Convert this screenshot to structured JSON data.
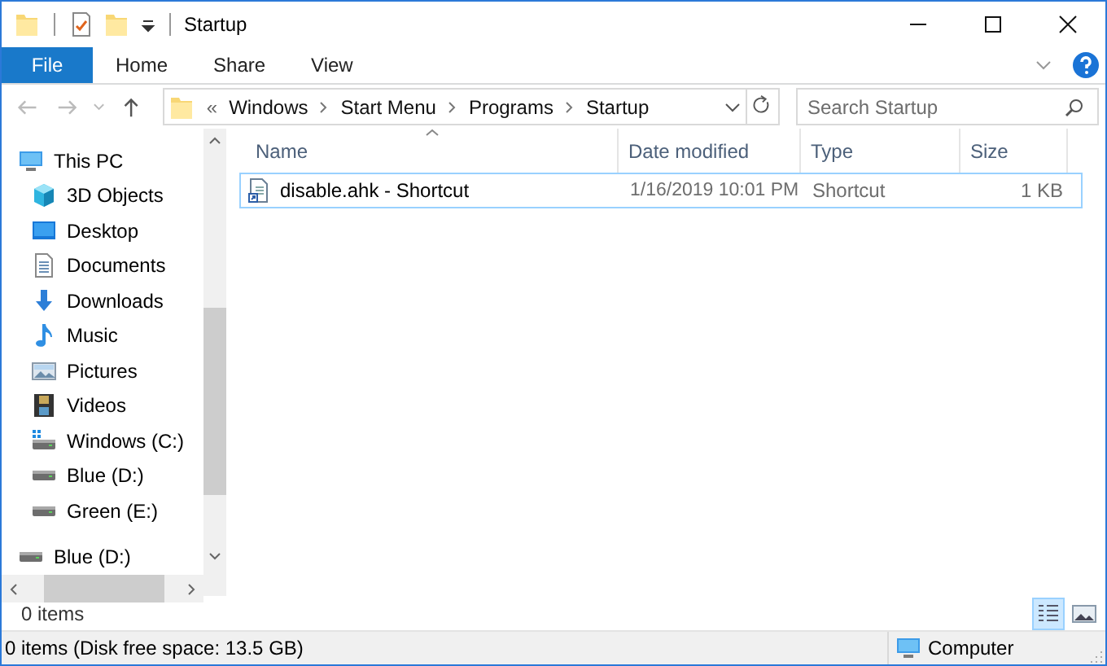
{
  "window": {
    "title": "Startup"
  },
  "ribbon_tabs": [
    {
      "label": "File",
      "selected": true
    },
    {
      "label": "Home",
      "selected": false
    },
    {
      "label": "Share",
      "selected": false
    },
    {
      "label": "View",
      "selected": false
    }
  ],
  "address": {
    "overflow": "«",
    "crumbs": [
      "Windows",
      "Start Menu",
      "Programs",
      "Startup"
    ]
  },
  "search": {
    "placeholder": "Search Startup"
  },
  "sidebar": {
    "items": [
      {
        "label": "This PC",
        "children": [
          {
            "label": "3D Objects"
          },
          {
            "label": "Desktop"
          },
          {
            "label": "Documents"
          },
          {
            "label": "Downloads"
          },
          {
            "label": "Music"
          },
          {
            "label": "Pictures"
          },
          {
            "label": "Videos"
          },
          {
            "label": "Windows (C:)"
          },
          {
            "label": "Blue (D:)"
          },
          {
            "label": "Green (E:)"
          }
        ]
      },
      {
        "label": "Blue (D:)"
      }
    ]
  },
  "table": {
    "columns": [
      "Name",
      "Date modified",
      "Type",
      "Size"
    ],
    "rows": [
      {
        "name": "disable.ahk - Shortcut",
        "date": "1/16/2019 10:01 PM",
        "type": "Shortcut",
        "size": "1 KB"
      }
    ]
  },
  "item_count": "0 items",
  "status_bar": {
    "text": "0 items (Disk free space: 13.5 GB)",
    "location": "Computer"
  }
}
